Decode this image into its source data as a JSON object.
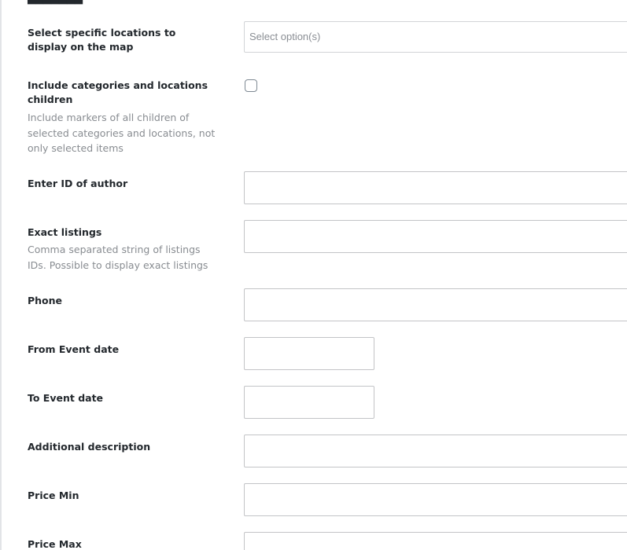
{
  "fields": {
    "locations": {
      "label": "Select specific locations to display on the map",
      "placeholder": "Select option(s)"
    },
    "include_children": {
      "label": "Include categories and locations children",
      "description": "Include markers of all children of selected categories and locations, not only selected items",
      "checked": false
    },
    "author_id": {
      "label": "Enter ID of author",
      "value": ""
    },
    "exact_listings": {
      "label": "Exact listings",
      "description": "Comma separated string of listings IDs. Possible to display exact listings",
      "value": ""
    },
    "phone": {
      "label": "Phone",
      "value": ""
    },
    "from_event_date": {
      "label": "From Event date",
      "value": ""
    },
    "to_event_date": {
      "label": "To Event date",
      "value": ""
    },
    "additional_description": {
      "label": "Additional description",
      "value": ""
    },
    "price_min": {
      "label": "Price Min",
      "value": ""
    },
    "price_max": {
      "label": "Price Max",
      "value": ""
    }
  }
}
